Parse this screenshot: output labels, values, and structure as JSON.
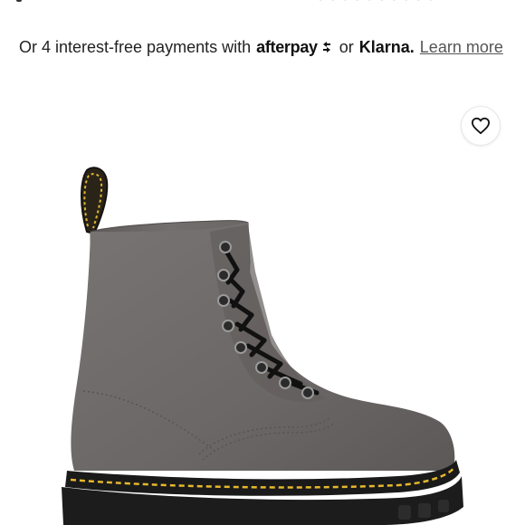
{
  "payment": {
    "prefix": "Or 4 interest-free payments with",
    "afterpay_logo_text": "afterpay",
    "connector": "or",
    "klarna_logo_text": "Klarna.",
    "learn_more": "Learn more"
  },
  "product": {
    "image_icon": "boot-image",
    "favorite_icon": "heart-icon"
  },
  "colors": {
    "boot_leather": "#6b6766",
    "sole": "#1c1c1c",
    "stitching": "#e6b82c",
    "background": "#ffffff"
  }
}
